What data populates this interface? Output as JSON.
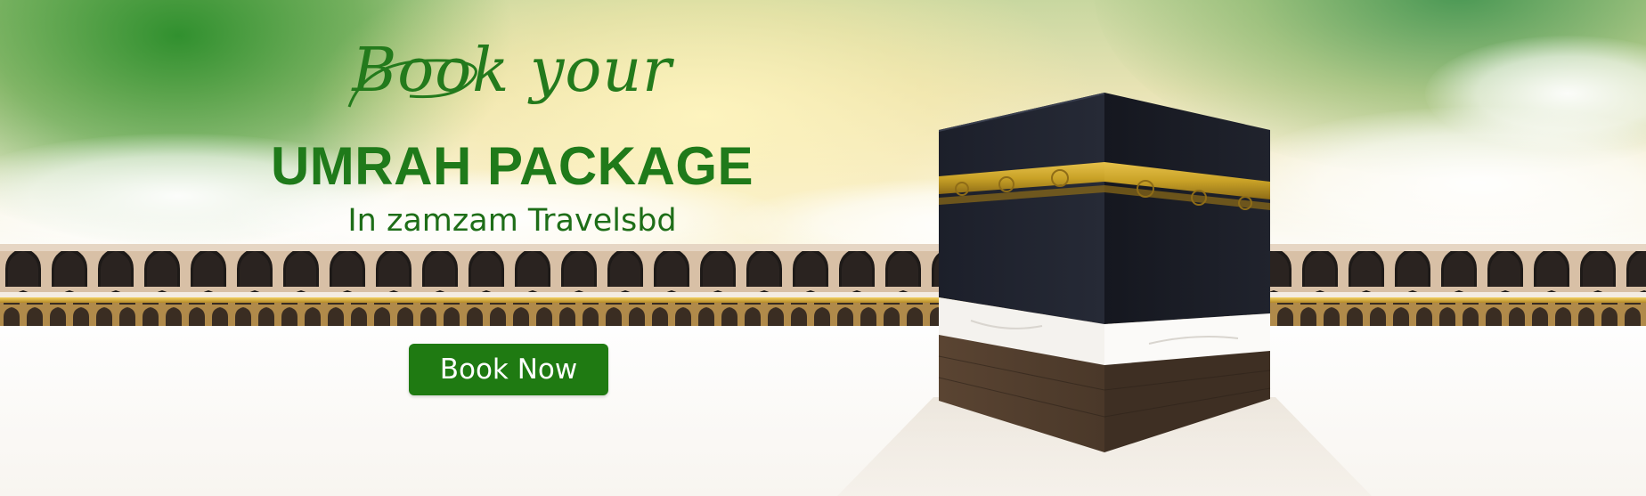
{
  "banner": {
    "script_text": "Book your",
    "title": "UMRAH PACKAGE",
    "subtitle": "In zamzam Travelsbd",
    "button_label": "Book Now"
  },
  "colors": {
    "brand_green": "#1f7a1a",
    "button_green": "#1f7a12",
    "kaaba_black": "#15171f",
    "kaaba_gold": "#c9a227"
  },
  "icons": {
    "kaaba": "kaaba-illustration",
    "colonnade": "mosque-arches"
  }
}
